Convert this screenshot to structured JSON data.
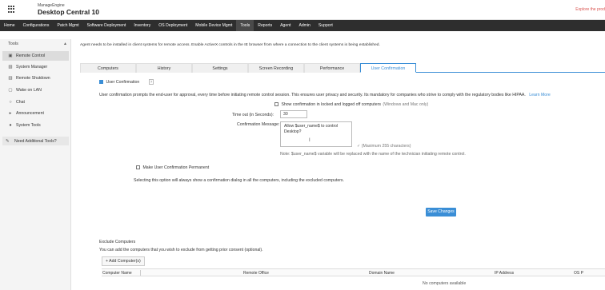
{
  "app": {
    "brand_small": "ManageEngine",
    "brand_name": "Desktop Central 10",
    "explore_link": "Explore the prod"
  },
  "nav": {
    "items": [
      "Home",
      "Configurations",
      "Patch Mgmt",
      "Software Deployment",
      "Inventory",
      "OS Deployment",
      "Mobile Device Mgmt",
      "Tools",
      "Reports",
      "Agent",
      "Admin",
      "Support"
    ],
    "active": "Tools"
  },
  "sidebar": {
    "title": "Tools",
    "items": [
      {
        "label": "Remote Control",
        "icon": "monitor-icon"
      },
      {
        "label": "System Manager",
        "icon": "system-manager-icon"
      },
      {
        "label": "Remote Shutdown",
        "icon": "shutdown-icon"
      },
      {
        "label": "Wake on LAN",
        "icon": "wake-on-lan-icon"
      },
      {
        "label": "Chat",
        "icon": "chat-icon"
      },
      {
        "label": "Announcement",
        "icon": "announcement-icon"
      },
      {
        "label": "System Tools",
        "icon": "system-tools-icon"
      }
    ],
    "help": "Need Additional Tools?"
  },
  "main": {
    "agent_note": "Agent needs to be installed in client systems for remote access. Enable ActiveX controls in the IE browser from where a connection to the client systems is being established.",
    "tabs": [
      "Computers",
      "History",
      "Settings",
      "Screen Recording",
      "Performance",
      "User Confirmation"
    ],
    "active_tab": "User Confirmation",
    "user_confirmation": {
      "checkbox_label": "User Confirmation",
      "help_glyph": "?",
      "description": "User confirmation prompts the end-user for approval, every time before initiating remote control session. This ensures user privacy and security. Its mandatory for companies who strive to comply with the regulatory bodies like HIPAA.",
      "learn_more": "Learn More",
      "show_confirmation_label": "Show confirmation in locked and logged off computers",
      "show_confirmation_suffix": "(Windows and Mac only)",
      "timeout_label": "Time out (in Seconds):",
      "timeout_value": "30",
      "message_label": "Confirmation Message:",
      "message_value": "Allow $user_name$ to control Desktop?",
      "max_chars": "(Maximum 255 characters)",
      "note": "Note: $user_name$ variable will be replaced with the name of the technician initiating remote control.",
      "permanent_label": "Make User Confirmation Permanent",
      "permanent_note": "Selecting this option will always show a confirmation dialog in all the computers, including the excluded computers.",
      "save_button": "Save Changes"
    },
    "exclude": {
      "title": "Exclude Computers",
      "description": "You can add the computers that you wish to exclude from getting prior consent (optional).",
      "add_button": "+ Add Computer(s)",
      "columns": [
        "Computer Name",
        "Remote Office",
        "Domain Name",
        "IP Address",
        "OS P"
      ],
      "empty": "No computers available"
    }
  }
}
